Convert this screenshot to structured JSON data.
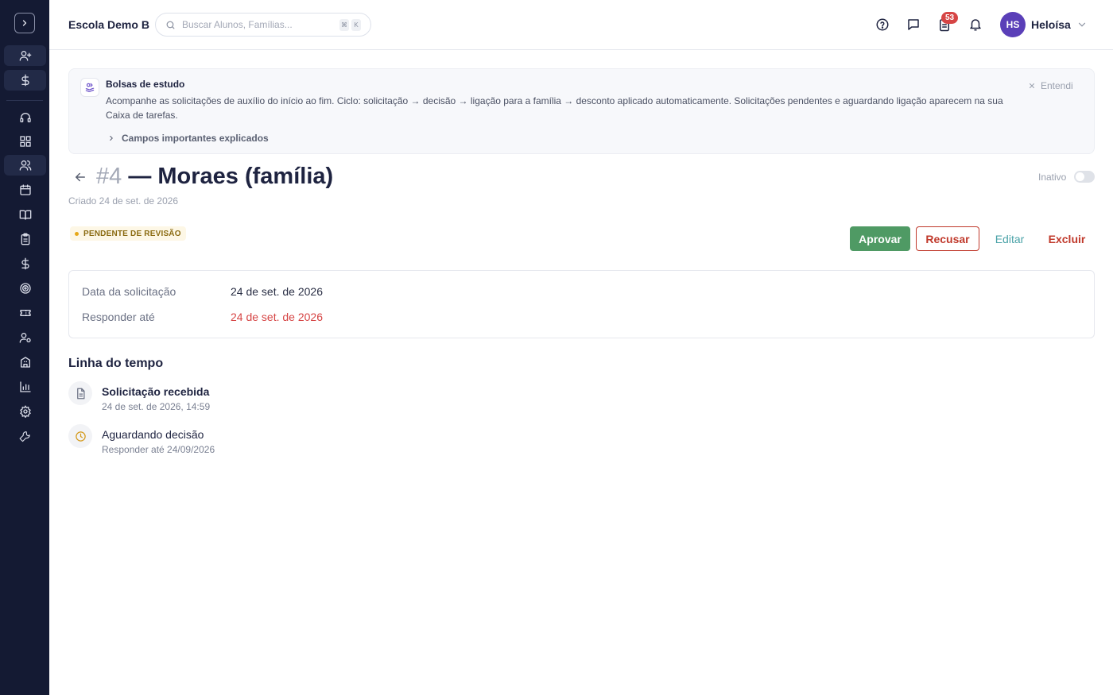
{
  "header": {
    "school": "Escola Demo B",
    "search_placeholder": "Buscar Alunos, Famílias...",
    "kbd_1": "⌘",
    "kbd_2": "K",
    "tasks_badge": "53",
    "user_initials": "HS",
    "user_name": "Heloísa"
  },
  "banner": {
    "title": "Bolsas de estudo",
    "text": "Acompanhe as solicitações de auxílio do início ao fim. Ciclo: solicitação → decisão → ligação para a família → desconto aplicado automaticamente. Solicitações pendentes e aguardando ligação aparecem na sua Caixa de tarefas.",
    "dismiss": "Entendi",
    "expand": "Campos importantes explicados"
  },
  "record": {
    "number": "#4",
    "title": " — Moraes (família)",
    "created": "Criado 24 de set. de 2026",
    "inactive_label": "Inativo",
    "status": "PENDENTE DE REVISÃO"
  },
  "actions": {
    "approve": "Aprovar",
    "reject": "Recusar",
    "edit": "Editar",
    "delete": "Excluir"
  },
  "details": {
    "request_date_label": "Data da solicitação",
    "request_date": "24 de set. de 2026",
    "respond_by_label": "Responder até",
    "respond_by": "24 de set. de 2026"
  },
  "timeline": {
    "heading": "Linha do tempo",
    "items": [
      {
        "title": "Solicitação recebida",
        "sub": "24 de set. de 2026, 14:59"
      },
      {
        "title": "Aguardando decisão",
        "sub": "Responder até 24/09/2026"
      }
    ]
  },
  "colors": {
    "sidebar_bg": "#141a33",
    "approve": "#4f9a64",
    "danger": "#c0392b",
    "edit": "#4ba3a8",
    "avatar": "#5a3fb8",
    "status_dot": "#e6a817"
  }
}
